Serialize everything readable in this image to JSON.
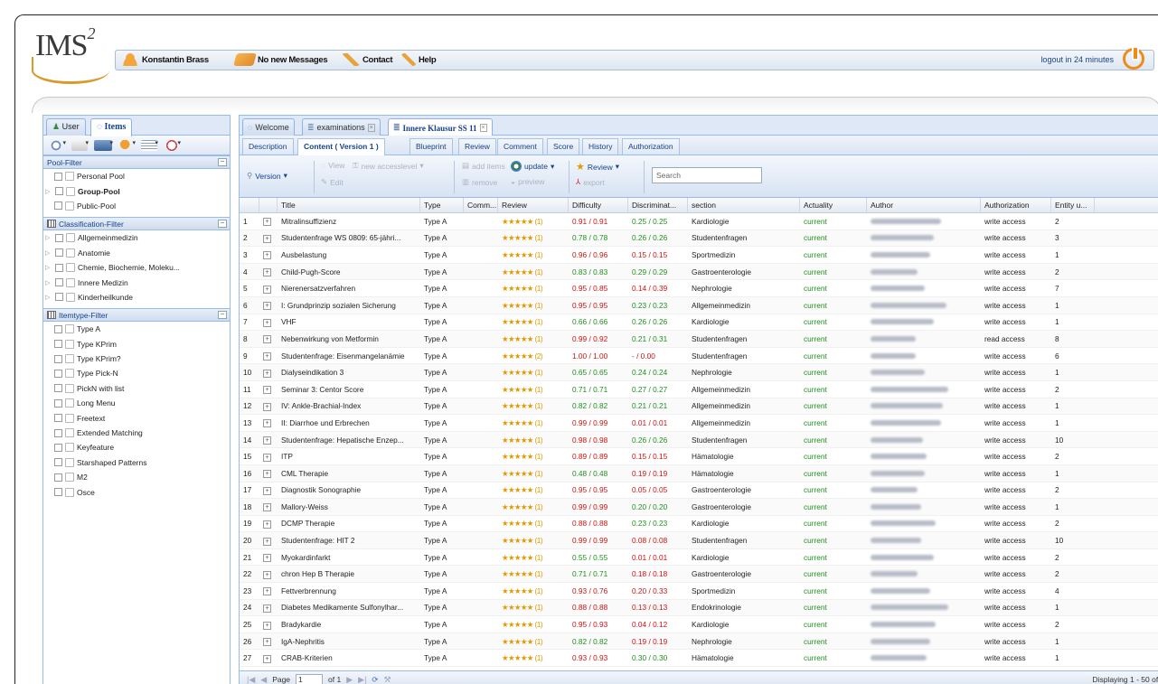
{
  "app": {
    "logo": "IMS",
    "logo_sup": "2"
  },
  "menu": {
    "user": "Konstantin Brass",
    "messages": "No new Messages",
    "contact": "Contact",
    "help": "Help",
    "logout": "logout in 24 minutes"
  },
  "sidebar": {
    "tabs": [
      "User",
      "Items"
    ],
    "pool_filter": {
      "title": "Pool-Filter",
      "items": [
        "Personal Pool",
        "Group-Pool",
        "Public-Pool"
      ]
    },
    "classification_filter": {
      "title": "Classification-Filter",
      "items": [
        "Allgemeinmedizin",
        "Anatomie",
        "Chemie, Biochemie, Moleku...",
        "Innere Medizin",
        "Kinderheilkunde"
      ]
    },
    "itemtype_filter": {
      "title": "Itemtype-Filter",
      "items": [
        "Type A",
        "Type KPrim",
        "Type KPrim?",
        "Type Pick-N",
        "PickN with list",
        "Long Menu",
        "Freetext",
        "Extended Matching",
        "Keyfeature",
        "Starshaped Patterns",
        "M2",
        "Osce"
      ]
    }
  },
  "main_tabs": [
    "Welcome",
    "examinations",
    "Innere Klausur SS 11"
  ],
  "sub_tabs": [
    "Description",
    "Content ( Version 1 )",
    "Blueprint",
    "Review",
    "Comment",
    "Score",
    "History",
    "Authorization"
  ],
  "toolbar": {
    "version": "Version",
    "view": "View",
    "new_accesslevel": "new accesslevel",
    "edit": "Edit",
    "add_items": "add items",
    "update": "update",
    "remove": "remove",
    "preview": "preview",
    "review": "Review",
    "export": "export",
    "search_placeholder": "Search"
  },
  "grid": {
    "columns": [
      "Title",
      "Type",
      "Comm...",
      "Review",
      "Difficulty",
      "Discriminat...",
      "section",
      "Actuality",
      "Author",
      "Authorization",
      "Entity u..."
    ],
    "rows": [
      {
        "n": "1",
        "title": "Mitralinsuffizienz",
        "type": "Type A",
        "review": "★★★★★ (1)",
        "diff": "0.91 / 0.91",
        "diffc": "red",
        "disc": "0.25 / 0.25",
        "discc": "green",
        "section": "Kardiologie",
        "act": "current",
        "auth": "write access",
        "ent": "2"
      },
      {
        "n": "2",
        "title": "Studentenfrage WS 0809: 65-jähri...",
        "type": "Type A",
        "review": "★★★★★ (1)",
        "diff": "0.78 / 0.78",
        "diffc": "green",
        "disc": "0.26 / 0.26",
        "discc": "green",
        "section": "Studentenfragen",
        "act": "current",
        "auth": "write access",
        "ent": "3"
      },
      {
        "n": "3",
        "title": "Ausbelastung",
        "type": "Type A",
        "review": "★★★★★ (1)",
        "diff": "0.96 / 0.96",
        "diffc": "red",
        "disc": "0.15 / 0.15",
        "discc": "red",
        "section": "Sportmedizin",
        "act": "current",
        "auth": "write access",
        "ent": "1"
      },
      {
        "n": "4",
        "title": "Child-Pugh-Score",
        "type": "Type A",
        "review": "★★★★★ (1)",
        "diff": "0.83 / 0.83",
        "diffc": "green",
        "disc": "0.29 / 0.29",
        "discc": "green",
        "section": "Gastroenterologie",
        "act": "current",
        "auth": "write access",
        "ent": "2"
      },
      {
        "n": "5",
        "title": "Nierenersatzverfahren",
        "type": "Type A",
        "review": "★★★★★ (1)",
        "diff": "0.95 / 0.85",
        "diffc": "red",
        "disc": "0.14 / 0.39",
        "discc": "red",
        "section": "Nephrologie",
        "act": "current",
        "auth": "write access",
        "ent": "7"
      },
      {
        "n": "6",
        "title": "I: Grundprinzip sozialen Sicherung",
        "type": "Type A",
        "review": "★★★★★ (1)",
        "diff": "0.95 / 0.95",
        "diffc": "red",
        "disc": "0.23 / 0.23",
        "discc": "green",
        "section": "Allgemeinmedizin",
        "act": "current",
        "auth": "write access",
        "ent": "1"
      },
      {
        "n": "7",
        "title": "VHF",
        "type": "Type A",
        "review": "★★★★★ (1)",
        "diff": "0.66 / 0.66",
        "diffc": "green",
        "disc": "0.26 / 0.26",
        "discc": "green",
        "section": "Kardiologie",
        "act": "current",
        "auth": "write access",
        "ent": "1"
      },
      {
        "n": "8",
        "title": "Nebenwirkung von Metformin",
        "type": "Type A",
        "review": "★★★★★ (1)",
        "diff": "0.99 / 0.92",
        "diffc": "red",
        "disc": "0.21 / 0.31",
        "discc": "green",
        "section": "Studentenfragen",
        "act": "current",
        "auth": "read access",
        "ent": "8"
      },
      {
        "n": "9",
        "title": "Studentenfrage: Eisenmangelanämie",
        "type": "Type A",
        "review": "★★★★★ (2)",
        "diff": "1.00 / 1.00",
        "diffc": "red",
        "disc": "- / 0.00",
        "discc": "red",
        "section": "Studentenfragen",
        "act": "current",
        "auth": "write access",
        "ent": "6"
      },
      {
        "n": "10",
        "title": "Dialyseindikation 3",
        "type": "Type A",
        "review": "★★★★★ (1)",
        "diff": "0.65 / 0.65",
        "diffc": "green",
        "disc": "0.24 / 0.24",
        "discc": "green",
        "section": "Nephrologie",
        "act": "current",
        "auth": "write access",
        "ent": "1"
      },
      {
        "n": "11",
        "title": "Seminar 3: Centor Score",
        "type": "Type A",
        "review": "★★★★★ (1)",
        "diff": "0.71 / 0.71",
        "diffc": "green",
        "disc": "0.27 / 0.27",
        "discc": "green",
        "section": "Allgemeinmedizin",
        "act": "current",
        "auth": "write access",
        "ent": "2"
      },
      {
        "n": "12",
        "title": "IV: Ankle-Brachial-Index",
        "type": "Type A",
        "review": "★★★★★ (1)",
        "diff": "0.82 / 0.82",
        "diffc": "green",
        "disc": "0.21 / 0.21",
        "discc": "green",
        "section": "Allgemeinmedizin",
        "act": "current",
        "auth": "write access",
        "ent": "1"
      },
      {
        "n": "13",
        "title": "II: Diarrhoe und Erbrechen",
        "type": "Type A",
        "review": "★★★★★ (1)",
        "diff": "0.99 / 0.99",
        "diffc": "red",
        "disc": "0.01 / 0.01",
        "discc": "red",
        "section": "Allgemeinmedizin",
        "act": "current",
        "auth": "write access",
        "ent": "1"
      },
      {
        "n": "14",
        "title": "Studentenfrage: Hepatische Enzep...",
        "type": "Type A",
        "review": "★★★★★ (1)",
        "diff": "0.98 / 0.98",
        "diffc": "red",
        "disc": "0.26 / 0.26",
        "discc": "green",
        "section": "Studentenfragen",
        "act": "current",
        "auth": "write access",
        "ent": "10"
      },
      {
        "n": "15",
        "title": "ITP",
        "type": "Type A",
        "review": "★★★★★ (1)",
        "diff": "0.89 / 0.89",
        "diffc": "red",
        "disc": "0.15 / 0.15",
        "discc": "red",
        "section": "Hämatologie",
        "act": "current",
        "auth": "write access",
        "ent": "2"
      },
      {
        "n": "16",
        "title": "CML Therapie",
        "type": "Type A",
        "review": "★★★★★ (1)",
        "diff": "0.48 / 0.48",
        "diffc": "green",
        "disc": "0.19 / 0.19",
        "discc": "red",
        "section": "Hämatologie",
        "act": "current",
        "auth": "write access",
        "ent": "1"
      },
      {
        "n": "17",
        "title": "Diagnostik Sonographie",
        "type": "Type A",
        "review": "★★★★★ (1)",
        "diff": "0.95 / 0.95",
        "diffc": "red",
        "disc": "0.05 / 0.05",
        "discc": "red",
        "section": "Gastroenterologie",
        "act": "current",
        "auth": "write access",
        "ent": "2"
      },
      {
        "n": "18",
        "title": "Mallory-Weiss",
        "type": "Type A",
        "review": "★★★★★ (1)",
        "diff": "0.99 / 0.99",
        "diffc": "red",
        "disc": "0.20 / 0.20",
        "discc": "green",
        "section": "Gastroenterologie",
        "act": "current",
        "auth": "write access",
        "ent": "1"
      },
      {
        "n": "19",
        "title": "DCMP Therapie",
        "type": "Type A",
        "review": "★★★★★ (1)",
        "diff": "0.88 / 0.88",
        "diffc": "red",
        "disc": "0.23 / 0.23",
        "discc": "green",
        "section": "Kardiologie",
        "act": "current",
        "auth": "write access",
        "ent": "2"
      },
      {
        "n": "20",
        "title": "Studentenfrage: HIT 2",
        "type": "Type A",
        "review": "★★★★★ (1)",
        "diff": "0.99 / 0.99",
        "diffc": "red",
        "disc": "0.08 / 0.08",
        "discc": "red",
        "section": "Studentenfragen",
        "act": "current",
        "auth": "write access",
        "ent": "10"
      },
      {
        "n": "21",
        "title": "Myokardinfarkt",
        "type": "Type A",
        "review": "★★★★★ (1)",
        "diff": "0.55 / 0.55",
        "diffc": "green",
        "disc": "0.01 / 0.01",
        "discc": "red",
        "section": "Kardiologie",
        "act": "current",
        "auth": "write access",
        "ent": "2"
      },
      {
        "n": "22",
        "title": "chron Hep B Therapie",
        "type": "Type A",
        "review": "★★★★★ (1)",
        "diff": "0.71 / 0.71",
        "diffc": "green",
        "disc": "0.18 / 0.18",
        "discc": "red",
        "section": "Gastroenterologie",
        "act": "current",
        "auth": "write access",
        "ent": "2"
      },
      {
        "n": "23",
        "title": "Fettverbrennung",
        "type": "Type A",
        "review": "★★★★★ (1)",
        "diff": "0.93 / 0.76",
        "diffc": "red",
        "disc": "0.20 / 0.33",
        "discc": "red",
        "section": "Sportmedizin",
        "act": "current",
        "auth": "write access",
        "ent": "4"
      },
      {
        "n": "24",
        "title": "Diabetes Medikamente Sulfonylhar...",
        "type": "Type A",
        "review": "★★★★★ (1)",
        "diff": "0.88 / 0.88",
        "diffc": "red",
        "disc": "0.13 / 0.13",
        "discc": "red",
        "section": "Endokrinologie",
        "act": "current",
        "auth": "write access",
        "ent": "1"
      },
      {
        "n": "25",
        "title": "Bradykardie",
        "type": "Type A",
        "review": "★★★★★ (1)",
        "diff": "0.95 / 0.93",
        "diffc": "red",
        "disc": "0.04 / 0.12",
        "discc": "red",
        "section": "Kardiologie",
        "act": "current",
        "auth": "write access",
        "ent": "2"
      },
      {
        "n": "26",
        "title": "IgA-Nephritis",
        "type": "Type A",
        "review": "★★★★★ (1)",
        "diff": "0.82 / 0.82",
        "diffc": "green",
        "disc": "0.19 / 0.19",
        "discc": "red",
        "section": "Nephrologie",
        "act": "current",
        "auth": "write access",
        "ent": "1"
      },
      {
        "n": "27",
        "title": "CRAB-Kriterien",
        "type": "Type A",
        "review": "★★★★★ (1)",
        "diff": "0.93 / 0.93",
        "diffc": "red",
        "disc": "0.30 / 0.30",
        "discc": "green",
        "section": "Hämatologie",
        "act": "current",
        "auth": "write access",
        "ent": "1"
      }
    ]
  },
  "pager": {
    "page_label": "Page",
    "page_value": "1",
    "of_label": "of 1",
    "display": "Displaying 1 - 50 of 50"
  },
  "colors": {
    "accent": "#15428b",
    "good": "#1f8f1f",
    "bad": "#d21010",
    "star": "#e29a00"
  }
}
